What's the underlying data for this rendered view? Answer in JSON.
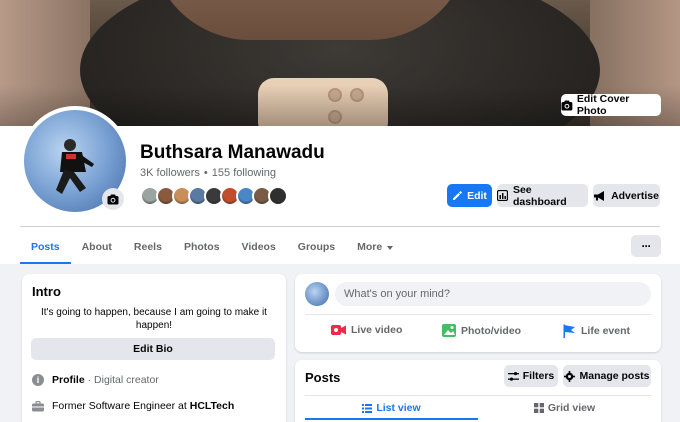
{
  "cover": {
    "edit_label": "Edit Cover Photo",
    "camera_icon": "camera-icon"
  },
  "profile": {
    "name": "Buthsara Manawadu",
    "followers": "3K followers",
    "separator": "•",
    "following": "155 following",
    "friend_avatar_colors": [
      "#9aa5a0",
      "#8a5a3c",
      "#c98f5a",
      "#5b7aa3",
      "#3a3a3a",
      "#c24d2c",
      "#4b86c7",
      "#7a5b45",
      "#2f2f2f"
    ]
  },
  "actions": {
    "edit": "Edit",
    "dashboard": "See dashboard",
    "advertise": "Advertise"
  },
  "tabs": [
    {
      "label": "Posts",
      "active": true
    },
    {
      "label": "About"
    },
    {
      "label": "Reels"
    },
    {
      "label": "Photos"
    },
    {
      "label": "Videos"
    },
    {
      "label": "Groups"
    },
    {
      "label": "More",
      "dropdown": true
    }
  ],
  "more_menu_label": "···",
  "intro": {
    "title": "Intro",
    "bio": "It's going to happen, because I am going to make it happen!",
    "edit_bio": "Edit Bio",
    "profile_label": "Profile",
    "profile_detail": "· Digital creator",
    "work_text": "Former Software Engineer at ",
    "work_company": "HCLTech"
  },
  "composer": {
    "placeholder": "What's on your mind?",
    "live_video": "Live video",
    "photo_video": "Photo/video",
    "life_event": "Life event"
  },
  "posts": {
    "title": "Posts",
    "filters": "Filters",
    "manage": "Manage posts",
    "list_view": "List view",
    "grid_view": "Grid view"
  },
  "colors": {
    "accent": "#1877f2",
    "live": "#f02849",
    "photo": "#45bd62",
    "event": "#1877f2"
  }
}
